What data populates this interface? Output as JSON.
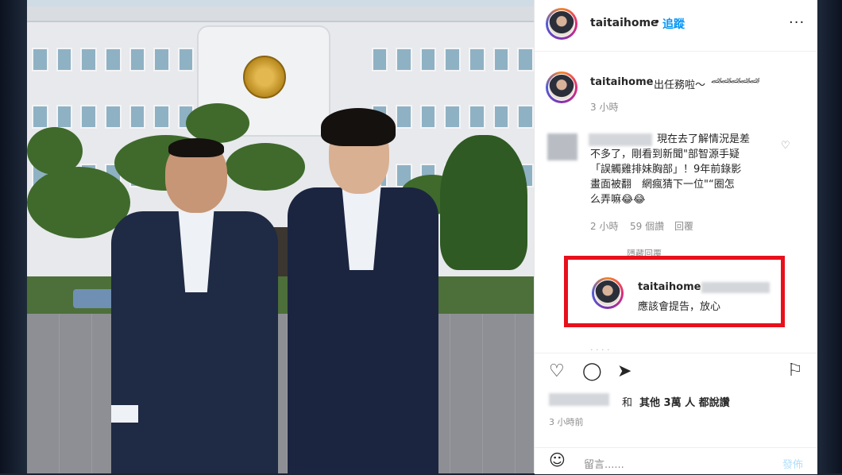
{
  "post": {
    "username": "taitaihome",
    "follow_label": "追蹤",
    "dot": "•",
    "more_label": "···"
  },
  "caption": {
    "username": "taitaihome",
    "text": "出任務啦～",
    "emoji": "🏎🏎🏎🏎🏎",
    "time": "3 小時"
  },
  "comment1": {
    "lines": [
      "現在去了解情況是差",
      "不多了，剛看到新聞\"部智源手疑",
      "「誤觸雞排妹胸部」！9年前錄影",
      "畫面被翻　網瘋猜下一位\"“圈怎",
      "么弄嘛😂😂"
    ],
    "time": "2 小時",
    "likes": "59 個讚",
    "reply": "回覆"
  },
  "hidden_replies": "隱藏回覆",
  "reply": {
    "username": "taitaihome",
    "text": "應該會提告，放心"
  },
  "actions": {
    "likes_prefix": "和",
    "likes_text": "其他 3萬 人 都說讚",
    "time": "3 小時前"
  },
  "add_comment": {
    "placeholder": "留言......",
    "post_label": "發佈"
  },
  "colors": {
    "accent": "#0095f6",
    "highlight_box": "#e8101c"
  }
}
